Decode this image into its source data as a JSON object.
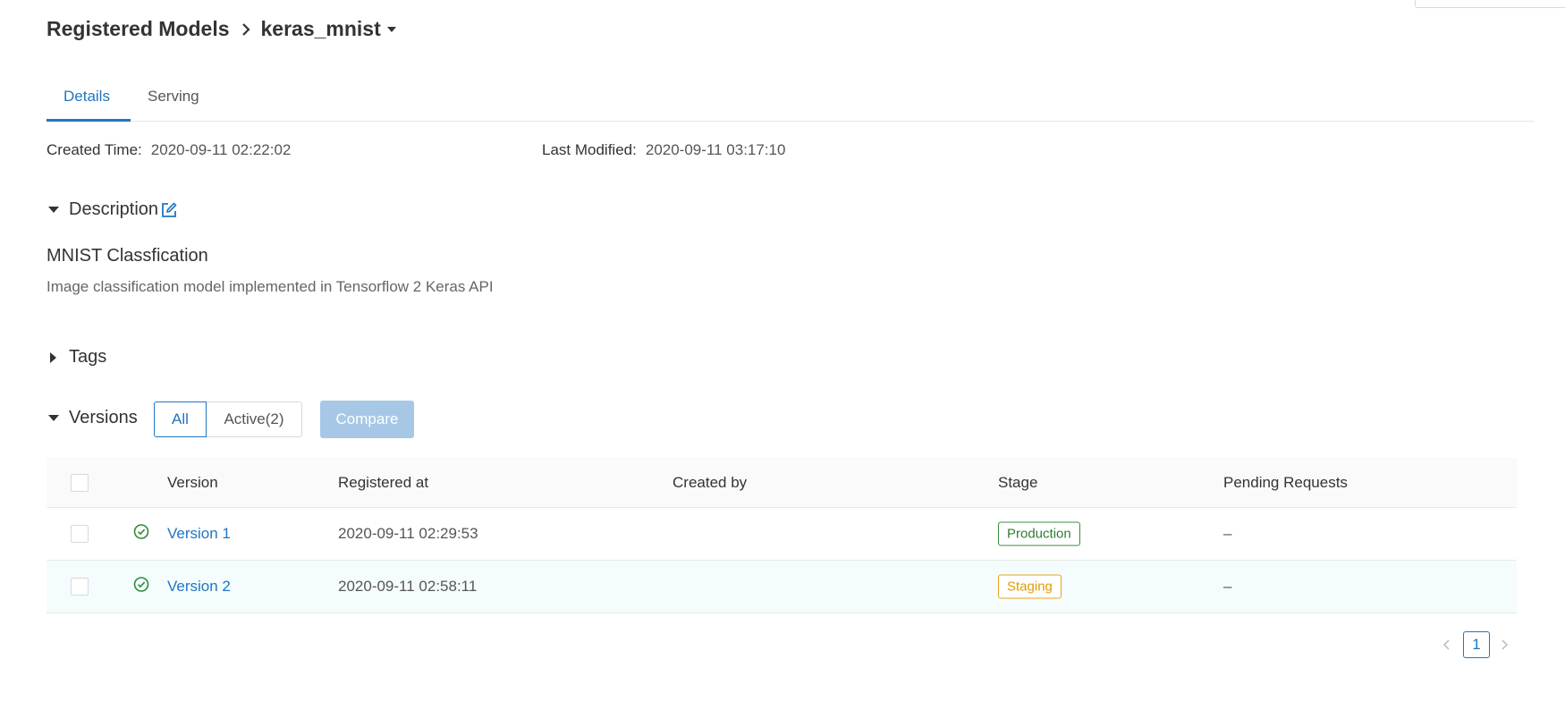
{
  "breadcrumb": {
    "parent": "Registered Models",
    "current": "keras_mnist"
  },
  "tabs": [
    {
      "label": "Details",
      "active": true
    },
    {
      "label": "Serving",
      "active": false
    }
  ],
  "meta": {
    "created_label": "Created Time",
    "created_value": "2020-09-11 02:22:02",
    "modified_label": "Last Modified",
    "modified_value": "2020-09-11 03:17:10"
  },
  "description": {
    "header": "Description",
    "title": "MNIST Classfication",
    "body": "Image classification model implemented in Tensorflow 2 Keras API"
  },
  "tags": {
    "header": "Tags"
  },
  "versions": {
    "header": "Versions",
    "filter_all": "All",
    "filter_active": "Active(2)",
    "compare_label": "Compare",
    "columns": [
      "Version",
      "Registered at",
      "Created by",
      "Stage",
      "Pending Requests"
    ],
    "rows": [
      {
        "version": "Version 1",
        "registered_at": "2020-09-11 02:29:53",
        "created_by": "",
        "stage": "Production",
        "pending": "–"
      },
      {
        "version": "Version 2",
        "registered_at": "2020-09-11 02:58:11",
        "created_by": "",
        "stage": "Staging",
        "pending": "–"
      }
    ]
  },
  "pagination": {
    "current_page": "1"
  },
  "colors": {
    "accent": "#1f75c4",
    "production": "#2e7d32",
    "staging": "#e39b00",
    "status_ok": "#2e8b3a"
  }
}
